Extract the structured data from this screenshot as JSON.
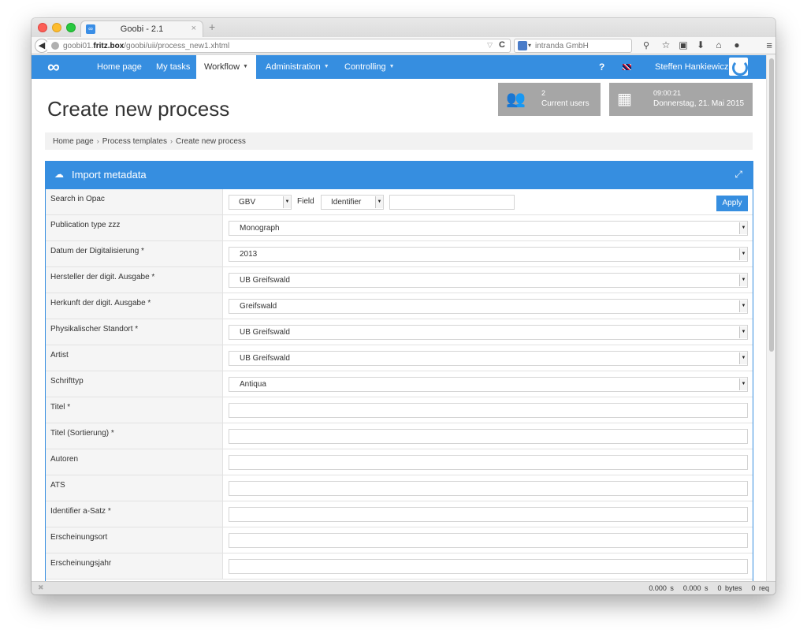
{
  "browser": {
    "tab_title": "Goobi - 2.1",
    "tab_close": "×",
    "new_tab": "+",
    "url_host_prefix": "goobi01.",
    "url_host_bold": "fritz.box",
    "url_path": "/goobi/uii/process_new1.xhtml",
    "search_engine_text": "intranda GmbH",
    "icons": [
      "star-icon",
      "clipboard-icon",
      "download-icon",
      "home-icon",
      "chat-icon",
      "menu-icon"
    ]
  },
  "topnav": {
    "logo": "∞",
    "items": [
      {
        "label": "Home page",
        "active": false,
        "dropdown": false
      },
      {
        "label": "My tasks",
        "active": false,
        "dropdown": false
      },
      {
        "label": "Workflow",
        "active": true,
        "dropdown": true
      },
      {
        "label": "Administration",
        "active": false,
        "dropdown": true
      },
      {
        "label": "Controlling",
        "active": false,
        "dropdown": true
      }
    ],
    "help": "?",
    "user_name": "Steffen Hankiewicz"
  },
  "page": {
    "title": "Create new process",
    "widgets": {
      "users_count": "2",
      "users_label": "Current users",
      "time": "09:00:21",
      "date": "Donnerstag, 21. Mai 2015"
    },
    "breadcrumb": [
      "Home page",
      "Process templates",
      "Create new process"
    ]
  },
  "panel": {
    "title": "Import metadata",
    "opac": {
      "label": "Search in Opac",
      "catalog": "GBV",
      "field_label": "Field",
      "field": "Identifier",
      "search_value": "",
      "apply_label": "Apply"
    },
    "rows": [
      {
        "label": "Publication type zzz",
        "type": "select",
        "value": "Monograph"
      },
      {
        "label": "Datum der Digitalisierung *",
        "type": "select",
        "value": "2013"
      },
      {
        "label": "Hersteller der digit. Ausgabe *",
        "type": "select",
        "value": "UB Greifswald"
      },
      {
        "label": "Herkunft der digit. Ausgabe *",
        "type": "select",
        "value": "Greifswald"
      },
      {
        "label": "Physikalischer Standort *",
        "type": "select",
        "value": "UB Greifswald"
      },
      {
        "label": "Artist",
        "type": "select",
        "value": "UB Greifswald"
      },
      {
        "label": "Schrifttyp",
        "type": "select",
        "value": "Antiqua"
      },
      {
        "label": "Titel *",
        "type": "input",
        "value": ""
      },
      {
        "label": "Titel (Sortierung) *",
        "type": "input",
        "value": ""
      },
      {
        "label": "Autoren",
        "type": "input",
        "value": ""
      },
      {
        "label": "ATS",
        "type": "input",
        "value": ""
      },
      {
        "label": "Identifier a-Satz *",
        "type": "input",
        "value": ""
      },
      {
        "label": "Erscheinungsort",
        "type": "input",
        "value": ""
      },
      {
        "label": "Erscheinungsjahr",
        "type": "input",
        "value": ""
      }
    ]
  },
  "statusbar": {
    "metrics": [
      "0.000 s",
      "0.000 s",
      "0 bytes",
      "0 req"
    ]
  },
  "colors": {
    "accent": "#368ee0",
    "widget_bg": "#a6a6a6",
    "label_bg": "#f5f5f5"
  }
}
